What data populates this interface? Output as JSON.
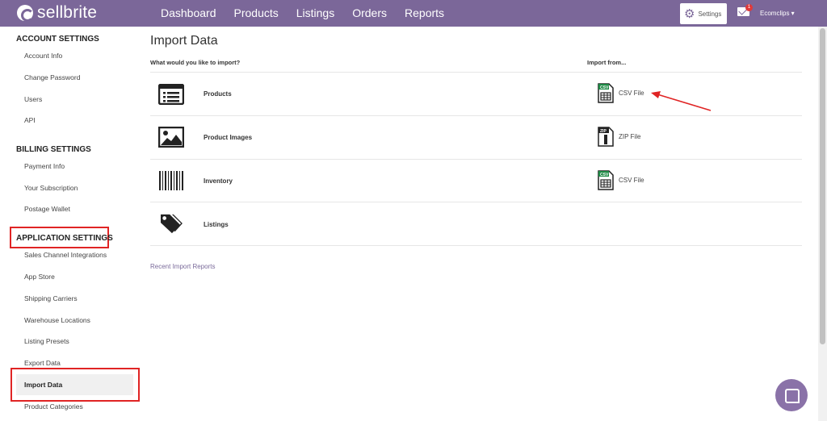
{
  "header": {
    "brand": "sellbrite",
    "nav": [
      "Dashboard",
      "Products",
      "Listings",
      "Orders",
      "Reports"
    ],
    "settings_label": "Settings",
    "mail_badge": "1",
    "user_label": "Ecomclips ▾"
  },
  "sidebar": {
    "account_title": "ACCOUNT SETTINGS",
    "account_items": [
      "Account Info",
      "Change Password",
      "Users",
      "API"
    ],
    "billing_title": "BILLING SETTINGS",
    "billing_items": [
      "Payment Info",
      "Your Subscription",
      "Postage Wallet"
    ],
    "app_title": "APPLICATION SETTINGS",
    "app_items": [
      "Sales Channel Integrations",
      "App Store",
      "Shipping Carriers",
      "Warehouse Locations",
      "Listing Presets",
      "Export Data",
      "Import Data",
      "Product Categories"
    ]
  },
  "main": {
    "title": "Import Data",
    "col_what": "What would you like to import?",
    "col_from": "Import from...",
    "rows": [
      {
        "label": "Products",
        "file": "CSV File",
        "file_tag": "CSV",
        "icon": "list-icon"
      },
      {
        "label": "Product Images",
        "file": "ZIP File",
        "file_tag": "ZIP",
        "icon": "image-icon"
      },
      {
        "label": "Inventory",
        "file": "CSV File",
        "file_tag": "CSV",
        "icon": "barcode-icon"
      },
      {
        "label": "Listings",
        "file": "",
        "file_tag": "",
        "icon": "tags-icon"
      }
    ],
    "recent_link": "Recent Import Reports"
  },
  "colors": {
    "brand": "#7b6799",
    "csv_green": "#1e8a45",
    "highlight_red": "#e02424"
  }
}
